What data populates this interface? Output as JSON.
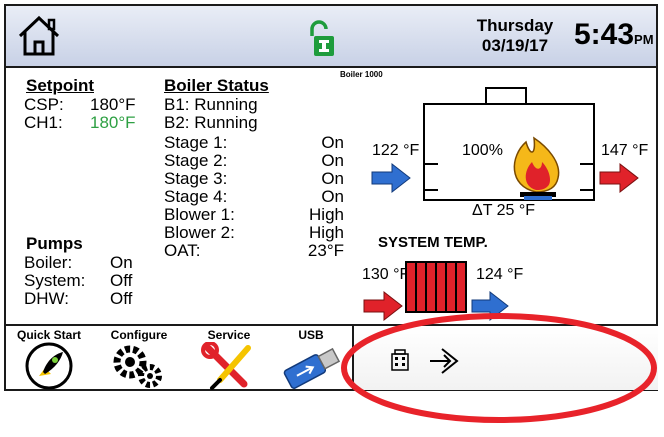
{
  "header": {
    "day": "Thursday",
    "date": "03/19/17",
    "time": "5:43",
    "meridiem": "PM",
    "model": "Boiler 1000"
  },
  "setpoint": {
    "title": "Setpoint",
    "rows": [
      {
        "label": "CSP:",
        "value": "180°F"
      },
      {
        "label": "CH1:",
        "value": "180°F",
        "color": "#2ea043"
      }
    ]
  },
  "pumps": {
    "title": "Pumps",
    "rows": [
      {
        "label": "Boiler:",
        "value": "On"
      },
      {
        "label": "System:",
        "value": "Off"
      },
      {
        "label": "DHW:",
        "value": "Off"
      }
    ]
  },
  "boiler_status": {
    "title": "Boiler Status",
    "b1": "B1: Running",
    "b2": "B2: Running",
    "rows": [
      {
        "label": "Stage 1:",
        "value": "On"
      },
      {
        "label": "Stage 2:",
        "value": "On"
      },
      {
        "label": "Stage 3:",
        "value": "On"
      },
      {
        "label": "Stage 4:",
        "value": "On"
      },
      {
        "label": "Blower 1:",
        "value": "High"
      },
      {
        "label": "Blower 2:",
        "value": "High"
      },
      {
        "label": "OAT:",
        "value": "23°F"
      }
    ]
  },
  "boiler_diagram": {
    "inlet_temp": "122 °F",
    "outlet_temp": "147 °F",
    "firing_rate": "100%",
    "delta_t": "ΔT 25 °F"
  },
  "system_temp": {
    "title": "SYSTEM TEMP.",
    "supply": "130 °F",
    "return": "124 °F"
  },
  "buttons": {
    "quick_start": "Quick Start",
    "configure": "Configure",
    "service": "Service",
    "usb": "USB"
  },
  "colors": {
    "header_bg": "#c8d1e6",
    "accent_green": "#2ea043",
    "arrow_blue": "#2f6fd0",
    "arrow_red": "#e0222a",
    "highlight_red": "#e8232a"
  }
}
